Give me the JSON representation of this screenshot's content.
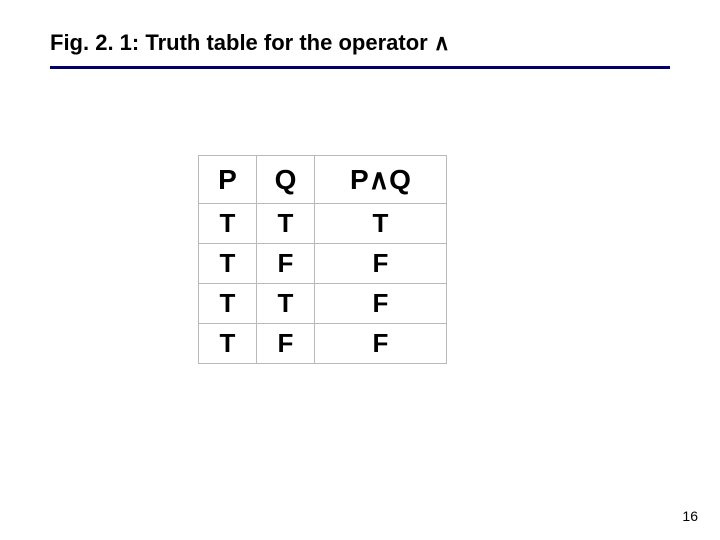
{
  "title": "Fig. 2. 1: Truth table for the operator ∧",
  "table": {
    "headers": {
      "p": "P",
      "q": "Q",
      "pq": "P∧Q"
    },
    "rows": [
      {
        "p": "T",
        "q": "T",
        "pq": "T"
      },
      {
        "p": "T",
        "q": "F",
        "pq": "F"
      },
      {
        "p": "T",
        "q": "T",
        "pq": "F"
      },
      {
        "p": "T",
        "q": "F",
        "pq": "F"
      }
    ]
  },
  "pageNumber": "16",
  "chart_data": {
    "type": "table",
    "title": "Fig. 2. 1: Truth table for the operator ∧",
    "columns": [
      "P",
      "Q",
      "P∧Q"
    ],
    "rows": [
      [
        "T",
        "T",
        "T"
      ],
      [
        "T",
        "F",
        "F"
      ],
      [
        "T",
        "T",
        "F"
      ],
      [
        "T",
        "F",
        "F"
      ]
    ]
  }
}
